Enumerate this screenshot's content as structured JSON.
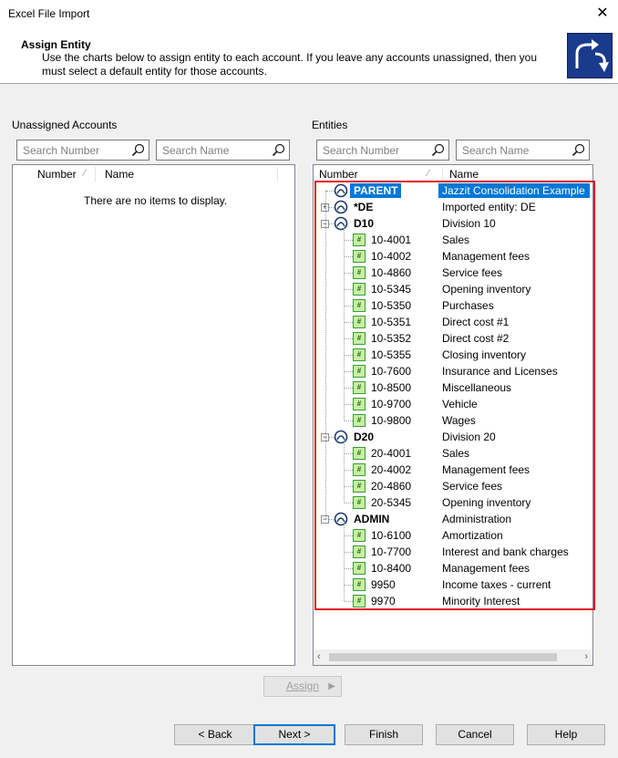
{
  "window": {
    "title": "Excel File Import",
    "close_glyph": "✕"
  },
  "header": {
    "title": "Assign Entity",
    "description": "Use the charts below to assign entity to each account. If you leave any accounts unassigned, then you must select a default entity for those accounts."
  },
  "left": {
    "label": "Unassigned Accounts",
    "search_number_placeholder": "Search Number",
    "search_name_placeholder": "Search Name",
    "col_number": "Number",
    "col_name": "Name",
    "empty_text": "There are no items to display."
  },
  "right": {
    "label": "Entities",
    "search_number_placeholder": "Search Number",
    "search_name_placeholder": "Search Name",
    "col_number": "Number",
    "col_name": "Name",
    "rows": [
      {
        "type": "entity",
        "number": "PARENT",
        "name": "Jazzit Consolidation Example",
        "selected": true
      },
      {
        "type": "entity",
        "number": "*DE",
        "name": "Imported entity: DE",
        "expander": "+"
      },
      {
        "type": "entity",
        "number": "D10",
        "name": "Division 10",
        "expander": "−"
      },
      {
        "type": "account",
        "number": "10-4001",
        "name": "Sales"
      },
      {
        "type": "account",
        "number": "10-4002",
        "name": "Management fees"
      },
      {
        "type": "account",
        "number": "10-4860",
        "name": "Service fees"
      },
      {
        "type": "account",
        "number": "10-5345",
        "name": "Opening inventory"
      },
      {
        "type": "account",
        "number": "10-5350",
        "name": "Purchases"
      },
      {
        "type": "account",
        "number": "10-5351",
        "name": "Direct cost #1"
      },
      {
        "type": "account",
        "number": "10-5352",
        "name": "Direct cost #2"
      },
      {
        "type": "account",
        "number": "10-5355",
        "name": "Closing inventory"
      },
      {
        "type": "account",
        "number": "10-7600",
        "name": "Insurance and Licenses"
      },
      {
        "type": "account",
        "number": "10-8500",
        "name": "Miscellaneous"
      },
      {
        "type": "account",
        "number": "10-9700",
        "name": "Vehicle"
      },
      {
        "type": "account",
        "number": "10-9800",
        "name": "Wages"
      },
      {
        "type": "entity",
        "number": "D20",
        "name": "Division 20",
        "expander": "−"
      },
      {
        "type": "account",
        "number": "20-4001",
        "name": "Sales"
      },
      {
        "type": "account",
        "number": "20-4002",
        "name": "Management fees"
      },
      {
        "type": "account",
        "number": "20-4860",
        "name": "Service fees"
      },
      {
        "type": "account",
        "number": "20-5345",
        "name": "Opening inventory"
      },
      {
        "type": "entity",
        "number": "ADMIN",
        "name": "Administration",
        "expander": "−"
      },
      {
        "type": "account",
        "number": "10-6100",
        "name": "Amortization"
      },
      {
        "type": "account",
        "number": "10-7700",
        "name": "Interest and bank charges"
      },
      {
        "type": "account",
        "number": "10-8400",
        "name": "Management fees"
      },
      {
        "type": "account",
        "number": "9950",
        "name": "Income taxes - current"
      },
      {
        "type": "account",
        "number": "9970",
        "name": "Minority Interest"
      }
    ]
  },
  "assign_button": "Assign",
  "buttons": {
    "back": "< Back",
    "next": "Next >",
    "finish": "Finish",
    "cancel": "Cancel",
    "help": "Help"
  },
  "colors": {
    "selection": "#0078d7",
    "highlight_box": "#e01020",
    "account_icon": "#c8f0a0",
    "logo_bg": "#1a3a8c"
  },
  "icons": {
    "search": "search-icon",
    "entity": "entity-icon",
    "account": "account-icon",
    "close": "close-icon",
    "logo": "wizard-logo-icon"
  }
}
